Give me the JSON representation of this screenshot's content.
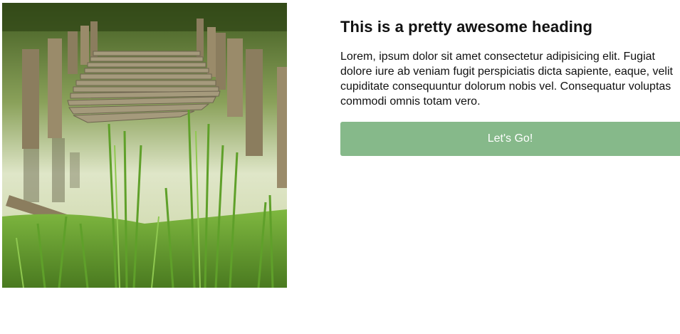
{
  "image": {
    "description_icon": "dock-photo"
  },
  "card": {
    "heading": "This is a pretty awesome heading",
    "paragraph": "Lorem, ipsum dolor sit amet consectetur adipisicing elit. Fugiat dolore iure ab veniam fugit perspiciatis dicta sapiente, eaque, velit cupiditate consequuntur dolorum nobis vel. Consequatur voluptas commodi omnis totam vero.",
    "button_label": "Let's Go!"
  },
  "colors": {
    "button": "#86b98a",
    "button_text": "#ffffff"
  }
}
